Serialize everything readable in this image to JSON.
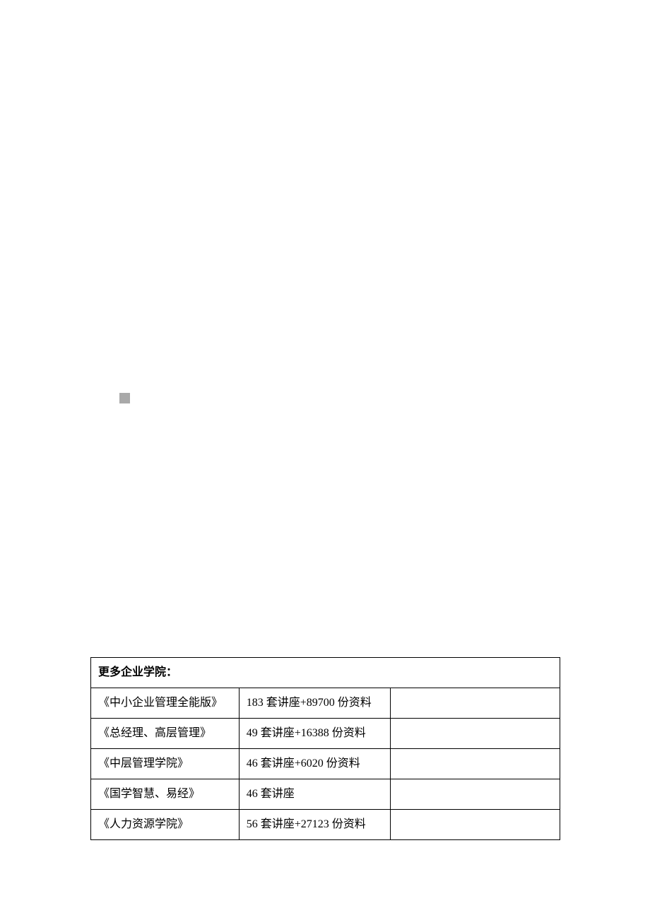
{
  "table": {
    "header": "更多企业学院：",
    "rows": [
      {
        "name": "《中小企业管理全能版》",
        "content": "183 套讲座+89700 份资料"
      },
      {
        "name": "《总经理、高层管理》",
        "content": "49 套讲座+16388 份资料"
      },
      {
        "name": "《中层管理学院》",
        "content": "46 套讲座+6020 份资料"
      },
      {
        "name": "《国学智慧、易经》",
        "content": "46 套讲座"
      },
      {
        "name": "《人力资源学院》",
        "content": "56 套讲座+27123 份资料"
      }
    ]
  }
}
